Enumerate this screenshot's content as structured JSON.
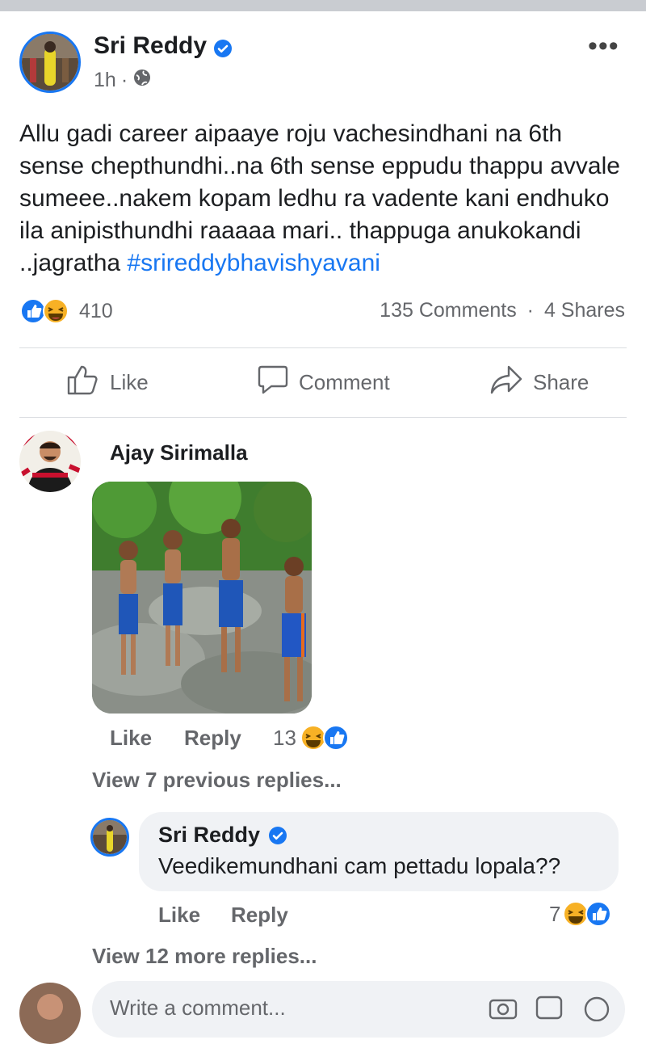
{
  "post": {
    "author": "Sri Reddy",
    "time": "1h",
    "separator": "·",
    "more_label": "•••",
    "text": "Allu gadi career aipaaye roju vachesindhani na 6th sense chepthundhi..na 6th sense eppudu thappu avvale sumeee..nakem kopam ledhu ra vadente kani endhuko ila anipisthundhi raaaaa mari..   thappuga anukokandi ..jagratha ",
    "hashtag": "#srireddybhavishyavani",
    "reaction_count": "410",
    "comments": "135 Comments",
    "shares": "4 Shares",
    "dot": "·"
  },
  "actions": {
    "like": "Like",
    "comment": "Comment",
    "share": "Share"
  },
  "comment": {
    "author": "Ajay Sirimalla",
    "like": "Like",
    "reply": "Reply",
    "reaction_count": "13",
    "view_previous": "View 7 previous replies..."
  },
  "reply": {
    "author": "Sri Reddy",
    "text": "Veedikemundhani cam pettadu lopala??",
    "like": "Like",
    "reply": "Reply",
    "reaction_count": "7",
    "view_more": "View 12 more replies..."
  },
  "composer": {
    "placeholder": "Write a comment..."
  },
  "colors": {
    "accent": "#1877f2",
    "muted": "#65676b",
    "bubble": "#f0f2f5",
    "haha": "#f7b125"
  }
}
